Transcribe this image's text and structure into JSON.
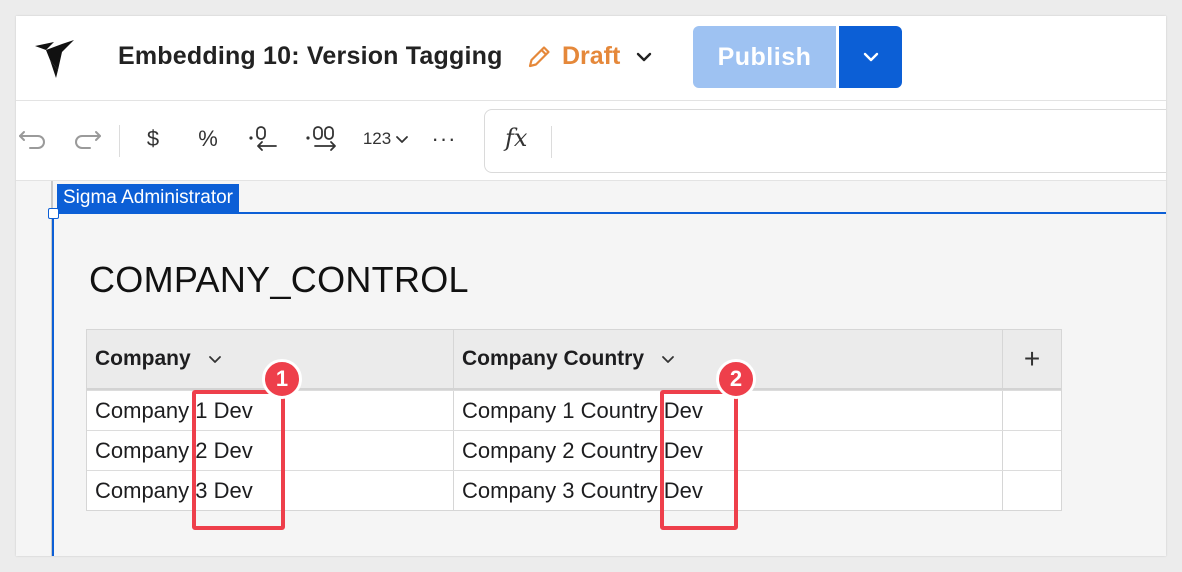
{
  "header": {
    "title": "Embedding 10: Version Tagging",
    "status_label": "Draft",
    "publish_label": "Publish"
  },
  "toolbar": {
    "currency_label": "$",
    "percent_label": "%",
    "number_format_label": "123",
    "more_label": "···",
    "formula_label": "fx"
  },
  "canvas": {
    "admin_tag": "Sigma Administrator",
    "element_title": "COMPANY_CONTROL"
  },
  "table": {
    "columns": [
      "Company",
      "Company Country"
    ],
    "add_column_label": "+",
    "rows": [
      [
        "Company 1 Dev",
        "Company 1 Country Dev"
      ],
      [
        "Company 2 Dev",
        "Company 2 Country Dev"
      ],
      [
        "Company 3 Dev",
        "Company 3 Country Dev"
      ]
    ]
  },
  "annotations": {
    "badge_1": "1",
    "badge_2": "2"
  },
  "colors": {
    "accent": "#0c5fd6",
    "draft": "#e5883a",
    "publish_disabled": "#9ec2f2",
    "highlight": "#ee3f4b"
  }
}
